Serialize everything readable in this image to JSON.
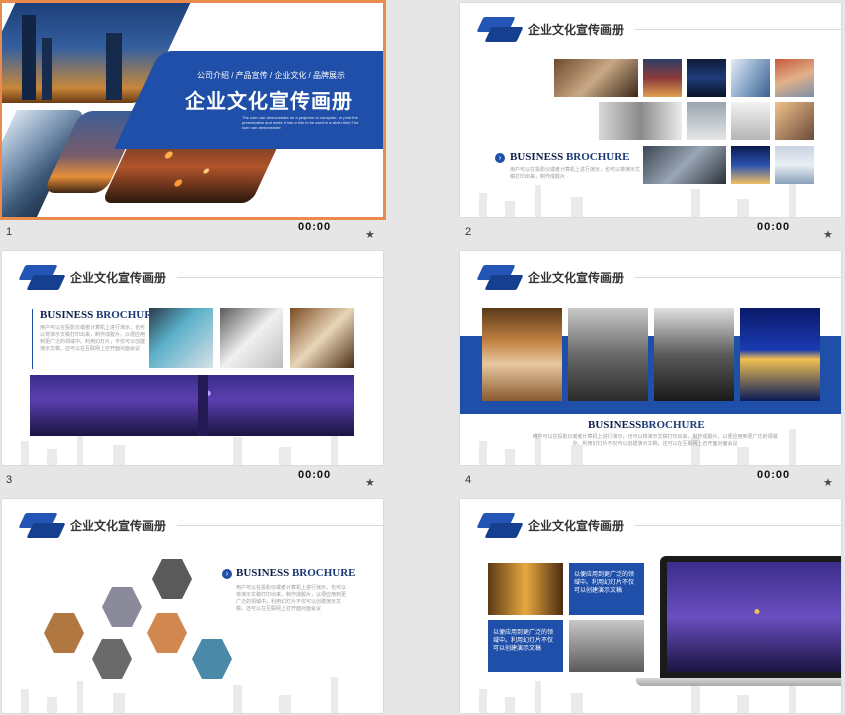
{
  "slides": [
    {
      "number": "1",
      "time": "00:00",
      "star": "★",
      "subtitle": "公司介绍 / 产品宣传 / 企业文化 / 品牌展示",
      "title": "企业文化宣传画册",
      "body": "The user can demonstrate on a projector or computer, or print the presentation and make it into a film to be used in a wider field The user can demonstrate"
    },
    {
      "number": "2",
      "time": "00:00",
      "star": "★",
      "header": "企业文化宣传画册",
      "brochure_bold": "BUSINESS",
      "brochure_rest": " BROCHURE",
      "body": "用户可以在投影仪或者计算机上进行演示，也可以将演示文稿打印出来，制作成胶片"
    },
    {
      "number": "3",
      "time": "00:00",
      "star": "★",
      "header": "企业文化宣传画册",
      "brochure_bold": "BUSINESS",
      "brochure_rest": " BROCHURE",
      "body": "用户可以在投影仪或者计算机上进行演示，也可以将演示文稿打印出来，制作成胶片，以便应用到更广泛的领域中。利用幻灯片，不仅可以创建演示文稿，还可以在互联网上召开面对面会议"
    },
    {
      "number": "4",
      "time": "00:00",
      "star": "★",
      "header": "企业文化宣传画册",
      "brochure_bold": "BUSINESS",
      "brochure_rest": "BROCHURE",
      "body": "用户可以在投影仪或者计算机上进行演示，也可以将演示文稿打印出来，制作成胶片，以便应用到更广泛的领域中。利用幻灯片不仅可以创建演示文稿，还可以在互联网上召开面对面会议"
    },
    {
      "number": "",
      "time": "",
      "star": "",
      "header": "企业文化宣传画册",
      "brochure_bold": "BUSINESS",
      "brochure_rest": " BROCHURE",
      "body": "用户可以在投影仪或者计算机上进行演示，也可以将演示文稿打印出来，制作成胶片，以便应用到更广泛的领域中。利用幻灯片不仅可以创建演示文稿，还可以在互联网上召开面对面会议"
    },
    {
      "number": "",
      "time": "",
      "star": "",
      "header": "企业文化宣传画册",
      "box1": "以便应用到更广泛的领域中。利用幻灯片不仅可以创建演示文稿",
      "box2": "以便应用到更广泛的领域中。利用幻灯片不仅可以创建演示文稿"
    }
  ],
  "colors": {
    "brand_blue": "#1f4fa8",
    "selection": "#e98a4f",
    "background": "#e6e6e6"
  }
}
